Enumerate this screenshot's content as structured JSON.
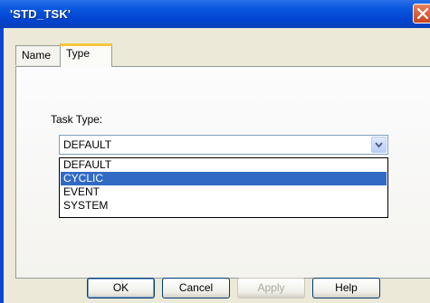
{
  "window": {
    "title": "'STD_TSK'"
  },
  "tabs": [
    {
      "label": "Name",
      "active": false
    },
    {
      "label": "Type",
      "active": true
    }
  ],
  "form": {
    "task_type_label": "Task Type:",
    "task_type_value": "DEFAULT",
    "options": [
      "DEFAULT",
      "CYCLIC",
      "EVENT",
      "SYSTEM"
    ],
    "highlighted_option": "CYCLIC"
  },
  "buttons": {
    "ok": "OK",
    "cancel": "Cancel",
    "apply": "Apply",
    "help": "Help"
  },
  "icons": {
    "close": "close-icon",
    "dropdown": "chevron-down-icon"
  },
  "colors": {
    "title_bar": "#0a57e0",
    "selection": "#316ac5",
    "close_button": "#c9421b"
  }
}
